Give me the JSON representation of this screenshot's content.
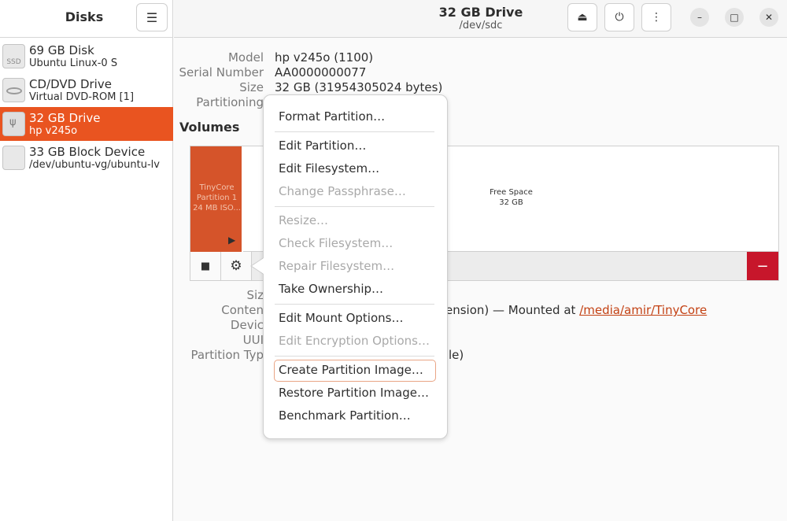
{
  "sidebar": {
    "title": "Disks",
    "disks": [
      {
        "name": "69 GB Disk",
        "sub": "Ubuntu Linux-0 S",
        "icon": "ssd-icon",
        "icon_text": "SSD"
      },
      {
        "name": "CD/DVD Drive",
        "sub": "Virtual DVD-ROM [1]",
        "icon": "optical-drive-icon"
      },
      {
        "name": "32 GB Drive",
        "sub": "hp v245o",
        "icon": "usb-drive-icon",
        "selected": true
      },
      {
        "name": "33 GB Block Device",
        "sub": "/dev/ubuntu-vg/ubuntu-lv",
        "icon": "block-device-icon"
      }
    ]
  },
  "header": {
    "title": "32 GB Drive",
    "subtitle": "/dev/sdc",
    "buttons": [
      "eject-icon",
      "power-icon",
      "more-icon"
    ],
    "window_buttons": [
      "minimize-icon",
      "maximize-icon",
      "close-icon"
    ]
  },
  "drive_info": {
    "model_label": "Model",
    "model_value": "hp v245o (1100)",
    "serial_label": "Serial Number",
    "serial_value": "AA0000000077",
    "size_label": "Size",
    "size_value": "32 GB (31954305024 bytes)",
    "partitioning_label": "Partitioning"
  },
  "volumes": {
    "title": "Volumes",
    "partition_name": "TinyCore",
    "partition_number": "Partition 1",
    "partition_size": "24 MB ISO...",
    "free_label": "Free Space",
    "free_size": "32 GB",
    "toolbar": [
      "stop-icon",
      "gear-icon",
      "minus-icon"
    ]
  },
  "partition_details": {
    "size_label": "Siz",
    "contents_label": "Conten",
    "contents_value": "ension) — Mounted at",
    "mount_link": "/media/amir/TinyCore",
    "device_label": "Devic",
    "uuid_label": "UUI",
    "partition_type_label": "Partition Typ",
    "partition_type_value": "le)"
  },
  "menu": {
    "items": [
      {
        "label": "Format Partition…",
        "enabled": true
      },
      {
        "label": "Edit Partition…",
        "enabled": true
      },
      {
        "label": "Edit Filesystem…",
        "enabled": true
      },
      {
        "label": "Change Passphrase…",
        "enabled": false
      },
      {
        "label": "Resize…",
        "enabled": false
      },
      {
        "label": "Check Filesystem…",
        "enabled": false
      },
      {
        "label": "Repair Filesystem…",
        "enabled": false
      },
      {
        "label": "Take Ownership…",
        "enabled": true
      },
      {
        "label": "Edit Mount Options…",
        "enabled": true
      },
      {
        "label": "Edit Encryption Options…",
        "enabled": false
      },
      {
        "label": "Create Partition Image…",
        "enabled": true,
        "focused": true
      },
      {
        "label": "Restore Partition Image…",
        "enabled": true
      },
      {
        "label": "Benchmark Partition…",
        "enabled": true
      }
    ]
  },
  "colors": {
    "accent": "#e95420",
    "partition": "#d5542a",
    "danger": "#c7162b",
    "link": "#c34113"
  }
}
